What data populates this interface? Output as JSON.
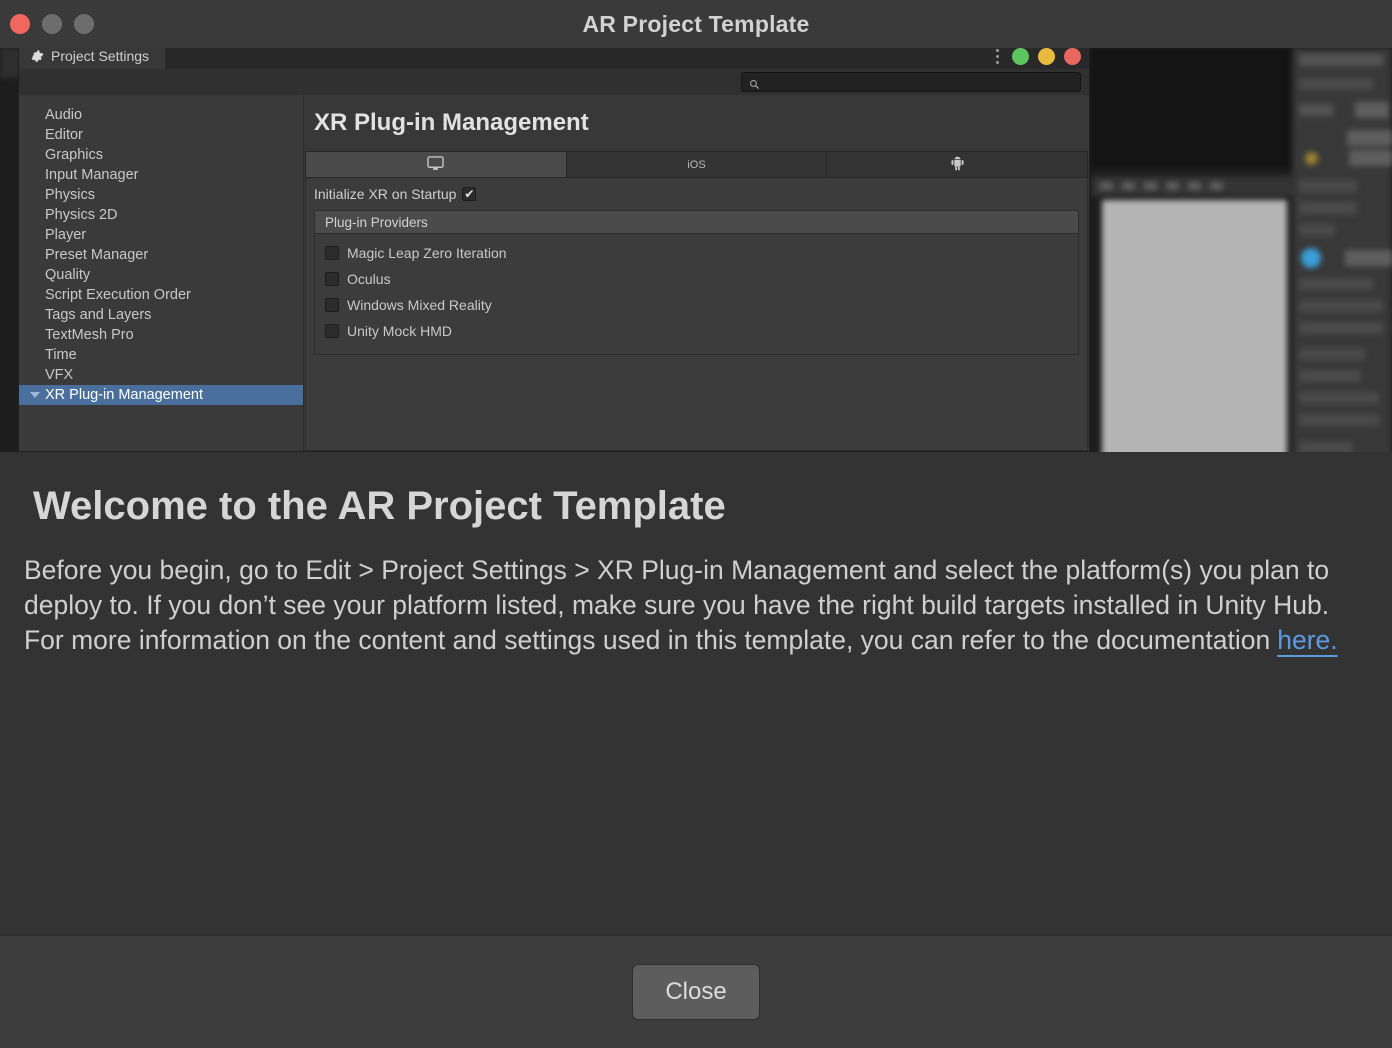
{
  "window": {
    "title": "AR Project Template",
    "traffic_lights": [
      {
        "name": "close",
        "color": "#f2675f"
      },
      {
        "name": "minimize",
        "color": "#6d6d6d"
      },
      {
        "name": "zoom",
        "color": "#6d6d6d"
      }
    ]
  },
  "project_settings": {
    "tab_label": "Project Settings",
    "tab_icon": "gear-icon",
    "window_buttons": [
      {
        "name": "menu-dots",
        "icon": "kebab-menu-icon"
      },
      {
        "name": "maximize",
        "color": "#5ec45e"
      },
      {
        "name": "minimize",
        "color": "#e8bb3c"
      },
      {
        "name": "close",
        "color": "#e8675f"
      }
    ],
    "search": {
      "icon": "search-icon",
      "value": "",
      "placeholder": ""
    },
    "sidebar": {
      "items": [
        {
          "label": "Audio",
          "selected": false
        },
        {
          "label": "Editor",
          "selected": false
        },
        {
          "label": "Graphics",
          "selected": false
        },
        {
          "label": "Input Manager",
          "selected": false
        },
        {
          "label": "Physics",
          "selected": false
        },
        {
          "label": "Physics 2D",
          "selected": false
        },
        {
          "label": "Player",
          "selected": false
        },
        {
          "label": "Preset Manager",
          "selected": false
        },
        {
          "label": "Quality",
          "selected": false
        },
        {
          "label": "Script Execution Order",
          "selected": false
        },
        {
          "label": "Tags and Layers",
          "selected": false
        },
        {
          "label": "TextMesh Pro",
          "selected": false
        },
        {
          "label": "Time",
          "selected": false
        },
        {
          "label": "VFX",
          "selected": false
        },
        {
          "label": "XR Plug-in Management",
          "selected": true
        }
      ]
    },
    "content": {
      "title": "XR Plug-in Management",
      "platform_tabs": [
        {
          "label": "",
          "icon": "desktop-monitor-icon",
          "active": true
        },
        {
          "label": "iOS",
          "icon": "",
          "active": false
        },
        {
          "label": "",
          "icon": "android-robot-icon",
          "active": false
        }
      ],
      "initialize_xr": {
        "label": "Initialize XR on Startup",
        "checked": true
      },
      "providers_header": "Plug-in Providers",
      "providers": [
        {
          "label": "Magic Leap Zero Iteration",
          "checked": false
        },
        {
          "label": "Oculus",
          "checked": false
        },
        {
          "label": "Windows Mixed Reality",
          "checked": false
        },
        {
          "label": "Unity Mock HMD",
          "checked": false
        }
      ]
    }
  },
  "overlay": {
    "title": "Welcome to the AR Project Template",
    "body_before_link": "Before you begin, go to Edit > Project Settings > XR Plug-in Management and select the platform(s) you plan to deploy to. If you don’t see your platform listed, make sure you have the right build targets installed in Unity Hub. For more information on the content and settings used in this template, you can refer to the documentation",
    "link_text": "here.",
    "link_color": "#5b9ae0",
    "close_label": "Close"
  }
}
